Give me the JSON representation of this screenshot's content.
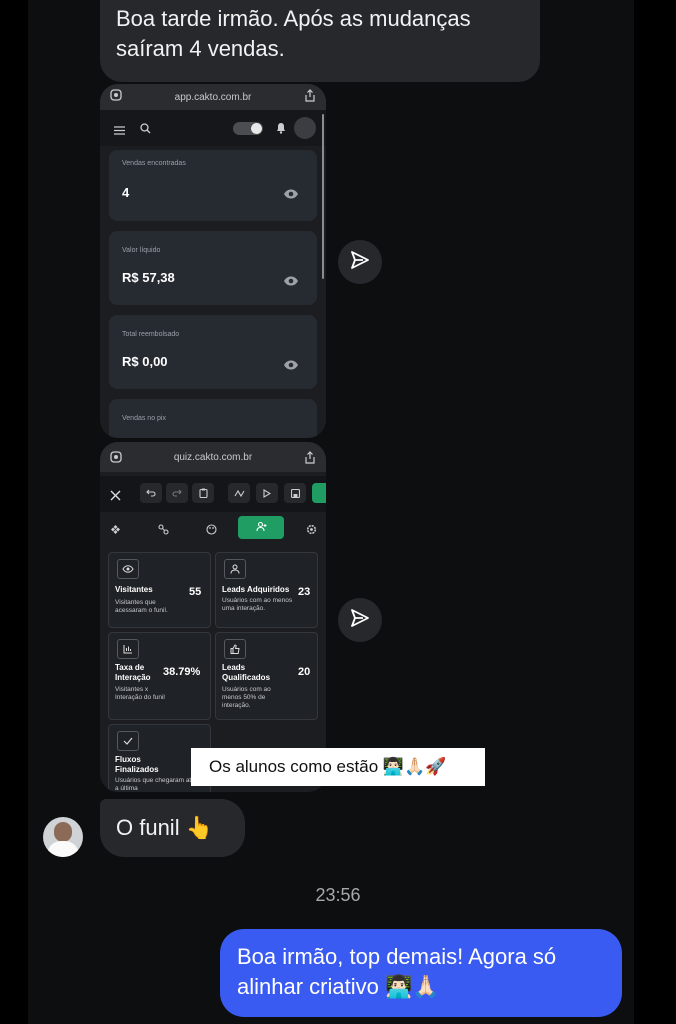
{
  "messages": {
    "top": "Boa tarde irmão. Após as mudanças saíram 4 vendas.",
    "funnel": "O funil 👆",
    "timestamp": "23:56",
    "reply": "Boa irmão, top demais! Agora só alinhar criativo 👨🏻‍💻🙏🏻"
  },
  "sticker": "Os alunos como estão 👨🏻‍💻🙏🏻🚀",
  "shot1": {
    "url": "app.cakto.com.br",
    "cards": [
      {
        "label": "Vendas encontradas",
        "value": "4"
      },
      {
        "label": "Valor líquido",
        "value": "R$ 57,38"
      },
      {
        "label": "Total reembolsado",
        "value": "R$ 0,00"
      },
      {
        "label": "Vendas no pix",
        "value": ""
      }
    ]
  },
  "shot2": {
    "url": "quiz.cakto.com.br",
    "stats": [
      {
        "title": "Visitantes",
        "desc": "Visitantes que acessaram o funil.",
        "value": "55",
        "icon": "eye-icon"
      },
      {
        "title": "Leads Adquiridos",
        "desc": "Usuários com ao menos uma interação.",
        "value": "23",
        "icon": "user-icon"
      },
      {
        "title": "Taxa de Interação",
        "desc": "Visitantes x Interação do funil",
        "value": "38.79%",
        "icon": "chart-icon"
      },
      {
        "title": "Leads Qualificados",
        "desc": "Usuários com ao menos 50% de interação.",
        "value": "20",
        "icon": "thumbs-up-icon"
      },
      {
        "title": "Fluxos Finalizados",
        "desc": "Usuários que chegaram até a última",
        "value": "",
        "icon": "check-icon"
      }
    ]
  },
  "colors": {
    "accent": "#3a5bf2",
    "green": "#1f9d63",
    "bubble": "#26282c"
  }
}
